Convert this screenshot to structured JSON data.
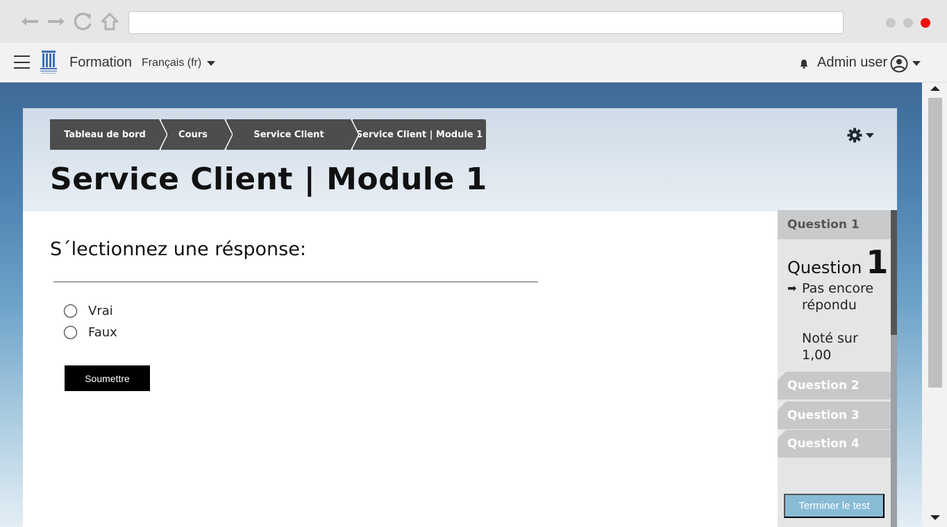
{
  "browser": {
    "url": "",
    "icons": [
      "back-arrow-icon",
      "forward-arrow-icon",
      "reload-icon",
      "home-icon"
    ]
  },
  "navbar": {
    "site_name": "Formation",
    "language": "Français (fr)",
    "user_name": "Admin user"
  },
  "breadcrumb": [
    {
      "label": "Tableau de bord"
    },
    {
      "label": "Cours"
    },
    {
      "label": "Service Client"
    },
    {
      "label": "Service Client | Module 1"
    }
  ],
  "page": {
    "title": "Service Client | Module 1"
  },
  "question": {
    "prompt": "S´lectionnez une résponse:",
    "options": [
      {
        "label": "Vrai"
      },
      {
        "label": "Faux"
      }
    ],
    "submit_label": "Soumettre"
  },
  "quiz_nav": {
    "header": "Question 1",
    "info_label": "Question",
    "info_number": "1",
    "state": "Pas encore répondu",
    "mark": "Noté sur 1,00",
    "tabs": [
      {
        "label": "Question 2"
      },
      {
        "label": "Question 3"
      },
      {
        "label": "Question 4"
      }
    ],
    "finish_label": "Terminer le test"
  },
  "colors": {
    "breadcrumb_bg": "#4d4d4d",
    "finish_button": "#88bbd6",
    "close_dot": "#ee1111"
  }
}
